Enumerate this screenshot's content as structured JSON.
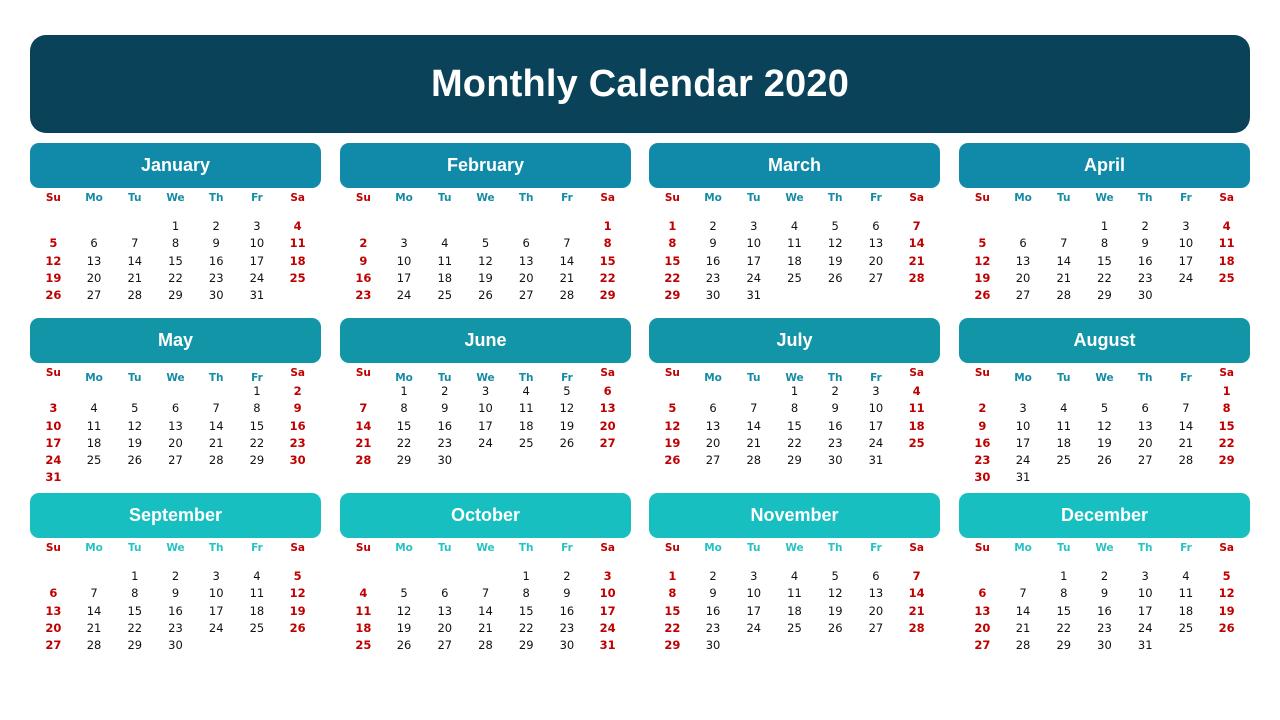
{
  "title": "Monthly Calendar 2020",
  "colors": {
    "title_bg": "#0a4259",
    "row1_header": "#108aa8",
    "row2_header": "#1295a6",
    "row3_header": "#17bfc0",
    "weekend": "#c00000"
  },
  "weekdays": [
    "Su",
    "Mo",
    "Tu",
    "We",
    "Th",
    "Fr",
    "Sa"
  ],
  "months": [
    {
      "name": "January",
      "weeks": [
        [
          "",
          "",
          "",
          "1",
          "2",
          "3",
          "4"
        ],
        [
          "5",
          "6",
          "7",
          "8",
          "9",
          "10",
          "11"
        ],
        [
          "12",
          "13",
          "14",
          "15",
          "16",
          "17",
          "18"
        ],
        [
          "19",
          "20",
          "21",
          "22",
          "23",
          "24",
          "25"
        ],
        [
          "26",
          "27",
          "28",
          "29",
          "30",
          "31",
          ""
        ]
      ]
    },
    {
      "name": "February",
      "weeks": [
        [
          "",
          "",
          "",
          "",
          "",
          "",
          "1"
        ],
        [
          "2",
          "3",
          "4",
          "5",
          "6",
          "7",
          "8"
        ],
        [
          "9",
          "10",
          "11",
          "12",
          "13",
          "14",
          "15"
        ],
        [
          "16",
          "17",
          "18",
          "19",
          "20",
          "21",
          "22"
        ],
        [
          "23",
          "24",
          "25",
          "26",
          "27",
          "28",
          "29"
        ]
      ]
    },
    {
      "name": "March",
      "weeks": [
        [
          "1",
          "2",
          "3",
          "4",
          "5",
          "6",
          "7"
        ],
        [
          "8",
          "9",
          "10",
          "11",
          "12",
          "13",
          "14"
        ],
        [
          "15",
          "16",
          "17",
          "18",
          "19",
          "20",
          "21"
        ],
        [
          "22",
          "23",
          "24",
          "25",
          "26",
          "27",
          "28"
        ],
        [
          "29",
          "30",
          "31",
          "",
          "",
          "",
          ""
        ]
      ]
    },
    {
      "name": "April",
      "weeks": [
        [
          "",
          "",
          "",
          "1",
          "2",
          "3",
          "4"
        ],
        [
          "5",
          "6",
          "7",
          "8",
          "9",
          "10",
          "11"
        ],
        [
          "12",
          "13",
          "14",
          "15",
          "16",
          "17",
          "18"
        ],
        [
          "19",
          "20",
          "21",
          "22",
          "23",
          "24",
          "25"
        ],
        [
          "26",
          "27",
          "28",
          "29",
          "30",
          "",
          ""
        ]
      ]
    },
    {
      "name": "May",
      "weeks": [
        [
          "",
          "",
          "",
          "",
          "",
          "1",
          "2"
        ],
        [
          "3",
          "4",
          "5",
          "6",
          "7",
          "8",
          "9"
        ],
        [
          "10",
          "11",
          "12",
          "13",
          "14",
          "15",
          "16"
        ],
        [
          "17",
          "18",
          "19",
          "20",
          "21",
          "22",
          "23"
        ],
        [
          "24",
          "25",
          "26",
          "27",
          "28",
          "29",
          "30"
        ],
        [
          "31",
          "",
          "",
          "",
          "",
          "",
          ""
        ]
      ]
    },
    {
      "name": "June",
      "weeks": [
        [
          "",
          "1",
          "2",
          "3",
          "4",
          "5",
          "6"
        ],
        [
          "7",
          "8",
          "9",
          "10",
          "11",
          "12",
          "13"
        ],
        [
          "14",
          "15",
          "16",
          "17",
          "18",
          "19",
          "20"
        ],
        [
          "21",
          "22",
          "23",
          "24",
          "25",
          "26",
          "27"
        ],
        [
          "28",
          "29",
          "30",
          "",
          "",
          "",
          ""
        ]
      ]
    },
    {
      "name": "July",
      "weeks": [
        [
          "",
          "",
          "",
          "1",
          "2",
          "3",
          "4"
        ],
        [
          "5",
          "6",
          "7",
          "8",
          "9",
          "10",
          "11"
        ],
        [
          "12",
          "13",
          "14",
          "15",
          "16",
          "17",
          "18"
        ],
        [
          "19",
          "20",
          "21",
          "22",
          "23",
          "24",
          "25"
        ],
        [
          "26",
          "27",
          "28",
          "29",
          "30",
          "31",
          ""
        ]
      ]
    },
    {
      "name": "August",
      "weeks": [
        [
          "",
          "",
          "",
          "",
          "",
          "",
          "1"
        ],
        [
          "2",
          "3",
          "4",
          "5",
          "6",
          "7",
          "8"
        ],
        [
          "9",
          "10",
          "11",
          "12",
          "13",
          "14",
          "15"
        ],
        [
          "16",
          "17",
          "18",
          "19",
          "20",
          "21",
          "22"
        ],
        [
          "23",
          "24",
          "25",
          "26",
          "27",
          "28",
          "29"
        ],
        [
          "30",
          "31",
          "",
          "",
          "",
          "",
          ""
        ]
      ]
    },
    {
      "name": "September",
      "weeks": [
        [
          "",
          "",
          "1",
          "2",
          "3",
          "4",
          "5"
        ],
        [
          "6",
          "7",
          "8",
          "9",
          "10",
          "11",
          "12"
        ],
        [
          "13",
          "14",
          "15",
          "16",
          "17",
          "18",
          "19"
        ],
        [
          "20",
          "21",
          "22",
          "23",
          "24",
          "25",
          "26"
        ],
        [
          "27",
          "28",
          "29",
          "30",
          "",
          "",
          ""
        ]
      ]
    },
    {
      "name": "October",
      "weeks": [
        [
          "",
          "",
          "",
          "",
          "1",
          "2",
          "3"
        ],
        [
          "4",
          "5",
          "6",
          "7",
          "8",
          "9",
          "10"
        ],
        [
          "11",
          "12",
          "13",
          "14",
          "15",
          "16",
          "17"
        ],
        [
          "18",
          "19",
          "20",
          "21",
          "22",
          "23",
          "24"
        ],
        [
          "25",
          "26",
          "27",
          "28",
          "29",
          "30",
          "31"
        ]
      ]
    },
    {
      "name": "November",
      "weeks": [
        [
          "1",
          "2",
          "3",
          "4",
          "5",
          "6",
          "7"
        ],
        [
          "8",
          "9",
          "10",
          "11",
          "12",
          "13",
          "14"
        ],
        [
          "15",
          "16",
          "17",
          "18",
          "19",
          "20",
          "21"
        ],
        [
          "22",
          "23",
          "24",
          "25",
          "26",
          "27",
          "28"
        ],
        [
          "29",
          "30",
          "",
          "",
          "",
          "",
          ""
        ]
      ]
    },
    {
      "name": "December",
      "weeks": [
        [
          "",
          "",
          "1",
          "2",
          "3",
          "4",
          "5"
        ],
        [
          "6",
          "7",
          "8",
          "9",
          "10",
          "11",
          "12"
        ],
        [
          "13",
          "14",
          "15",
          "16",
          "17",
          "18",
          "19"
        ],
        [
          "20",
          "21",
          "22",
          "23",
          "24",
          "25",
          "26"
        ],
        [
          "27",
          "28",
          "29",
          "30",
          "31",
          "",
          ""
        ]
      ]
    }
  ]
}
